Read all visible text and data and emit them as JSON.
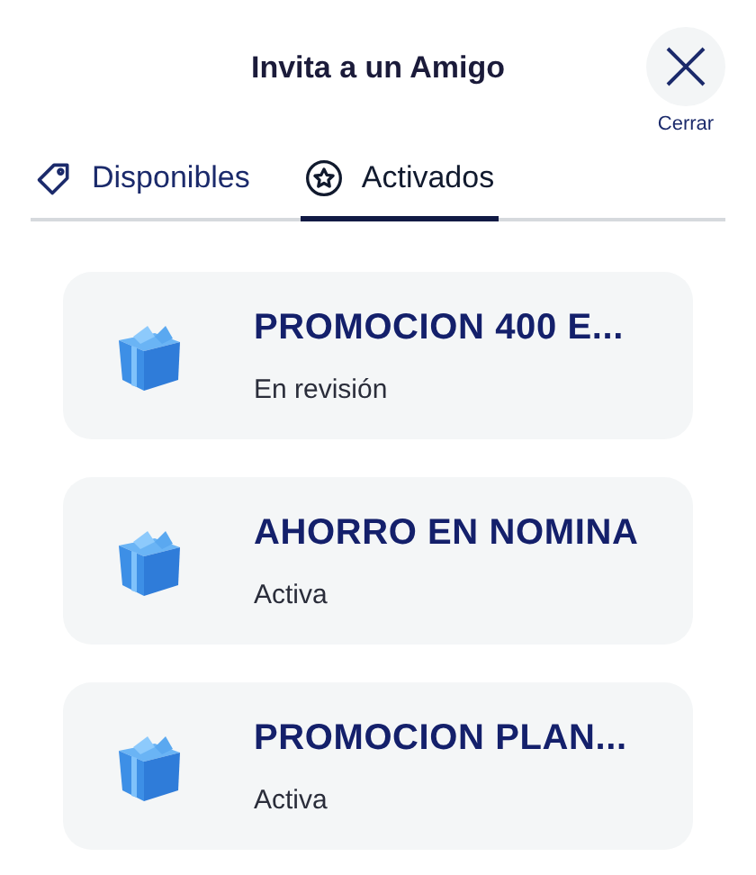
{
  "header": {
    "title": "Invita a un Amigo",
    "close_label": "Cerrar"
  },
  "tabs": [
    {
      "label": "Disponibles",
      "kind": "tag",
      "selected": false
    },
    {
      "label": "Activados",
      "kind": "star",
      "selected": true
    }
  ],
  "promotions": [
    {
      "title": "PROMOCION 400 E...",
      "status": "En revisión"
    },
    {
      "title": "AHORRO EN NOMINA",
      "status": "Activa"
    },
    {
      "title": "PROMOCION PLAN...",
      "status": "Activa"
    }
  ]
}
